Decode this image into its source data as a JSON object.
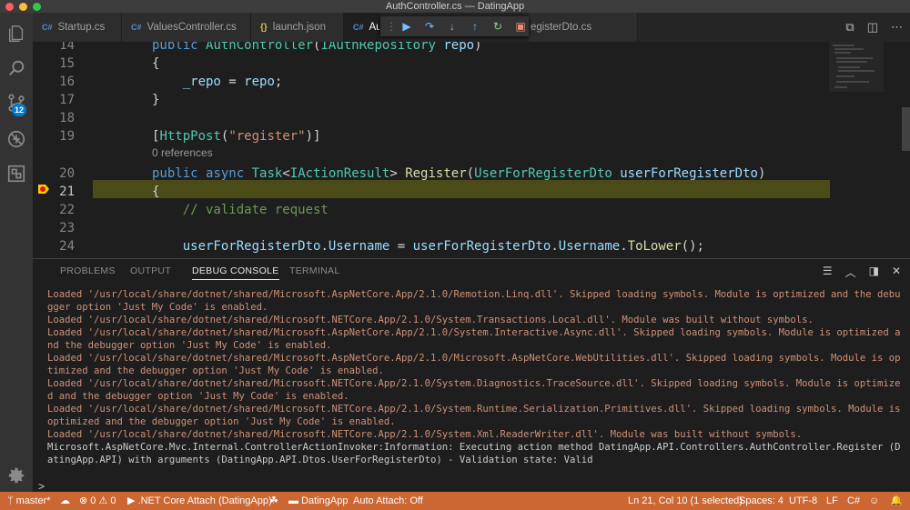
{
  "window": {
    "title": "AuthController.cs — DatingApp"
  },
  "colors": {
    "statusbar": "#cc6633",
    "accent": "#007acc",
    "highlight": "#4b4b18"
  },
  "activity": {
    "scm_badge": "12"
  },
  "tabs": [
    {
      "label": "Startup.cs",
      "icon": "C#"
    },
    {
      "label": "ValuesController.cs",
      "icon": "C#"
    },
    {
      "label": "launch.json",
      "icon": "{}"
    },
    {
      "label": "Au",
      "icon": "C#"
    },
    {
      "label": "egisterDto.cs",
      "icon": ""
    }
  ],
  "editor": {
    "lines": [
      {
        "n": "14",
        "text": "public AuthController(IAuthRepository repo)"
      },
      {
        "n": "15",
        "text": "{"
      },
      {
        "n": "16",
        "text": "    _repo = repo;"
      },
      {
        "n": "17",
        "text": "}"
      },
      {
        "n": "18",
        "text": ""
      },
      {
        "n": "19",
        "text": "[HttpPost(\"register\")]"
      },
      {
        "n": "20",
        "text": "public async Task<IActionResult> Register(UserForRegisterDto userForRegisterDto)"
      },
      {
        "n": "21",
        "text": "{"
      },
      {
        "n": "22",
        "text": "    // validate request"
      },
      {
        "n": "23",
        "text": ""
      },
      {
        "n": "24",
        "text": "    userForRegisterDto.Username = userForRegisterDto.Username.ToLower();"
      }
    ],
    "codelens": "0 references"
  },
  "panel": {
    "tabs": [
      "PROBLEMS",
      "OUTPUT",
      "DEBUG CONSOLE",
      "TERMINAL"
    ],
    "active_tab": "DEBUG CONSOLE",
    "console_lines": [
      {
        "kind": "warn",
        "text": "Loaded '/usr/local/share/dotnet/shared/Microsoft.AspNetCore.App/2.1.0/Remotion.Linq.dll'. Skipped loading symbols. Module is optimized and the debugger option 'Just My Code' is enabled."
      },
      {
        "kind": "warn",
        "text": "Loaded '/usr/local/share/dotnet/shared/Microsoft.NETCore.App/2.1.0/System.Transactions.Local.dll'. Module was built without symbols."
      },
      {
        "kind": "warn",
        "text": "Loaded '/usr/local/share/dotnet/shared/Microsoft.AspNetCore.App/2.1.0/System.Interactive.Async.dll'. Skipped loading symbols. Module is optimized and the debugger option 'Just My Code' is enabled."
      },
      {
        "kind": "warn",
        "text": "Loaded '/usr/local/share/dotnet/shared/Microsoft.AspNetCore.App/2.1.0/Microsoft.AspNetCore.WebUtilities.dll'. Skipped loading symbols. Module is optimized and the debugger option 'Just My Code' is enabled."
      },
      {
        "kind": "warn",
        "text": "Loaded '/usr/local/share/dotnet/shared/Microsoft.NETCore.App/2.1.0/System.Diagnostics.TraceSource.dll'. Skipped loading symbols. Module is optimized and the debugger option 'Just My Code' is enabled."
      },
      {
        "kind": "warn",
        "text": "Loaded '/usr/local/share/dotnet/shared/Microsoft.NETCore.App/2.1.0/System.Runtime.Serialization.Primitives.dll'. Skipped loading symbols. Module is optimized and the debugger option 'Just My Code' is enabled."
      },
      {
        "kind": "warn",
        "text": "Loaded '/usr/local/share/dotnet/shared/Microsoft.NETCore.App/2.1.0/System.Xml.ReaderWriter.dll'. Module was built without symbols."
      },
      {
        "kind": "info",
        "text": "Microsoft.AspNetCore.Mvc.Internal.ControllerActionInvoker:Information: Executing action method DatingApp.API.Controllers.AuthController.Register (DatingApp.API) with arguments (DatingApp.API.Dtos.UserForRegisterDto) - Validation state: Valid"
      }
    ],
    "prompt": ">"
  },
  "status": {
    "branch": "master*",
    "errors": "0",
    "warnings": "0",
    "debug_target": ".NET Core Attach (DatingApp)",
    "project": "DatingApp",
    "auto_attach": "Auto Attach: Off",
    "position": "Ln 21, Col 10 (1 selected)",
    "spaces": "Spaces: 4",
    "encoding": "UTF-8",
    "eol": "LF",
    "language": "C#"
  }
}
